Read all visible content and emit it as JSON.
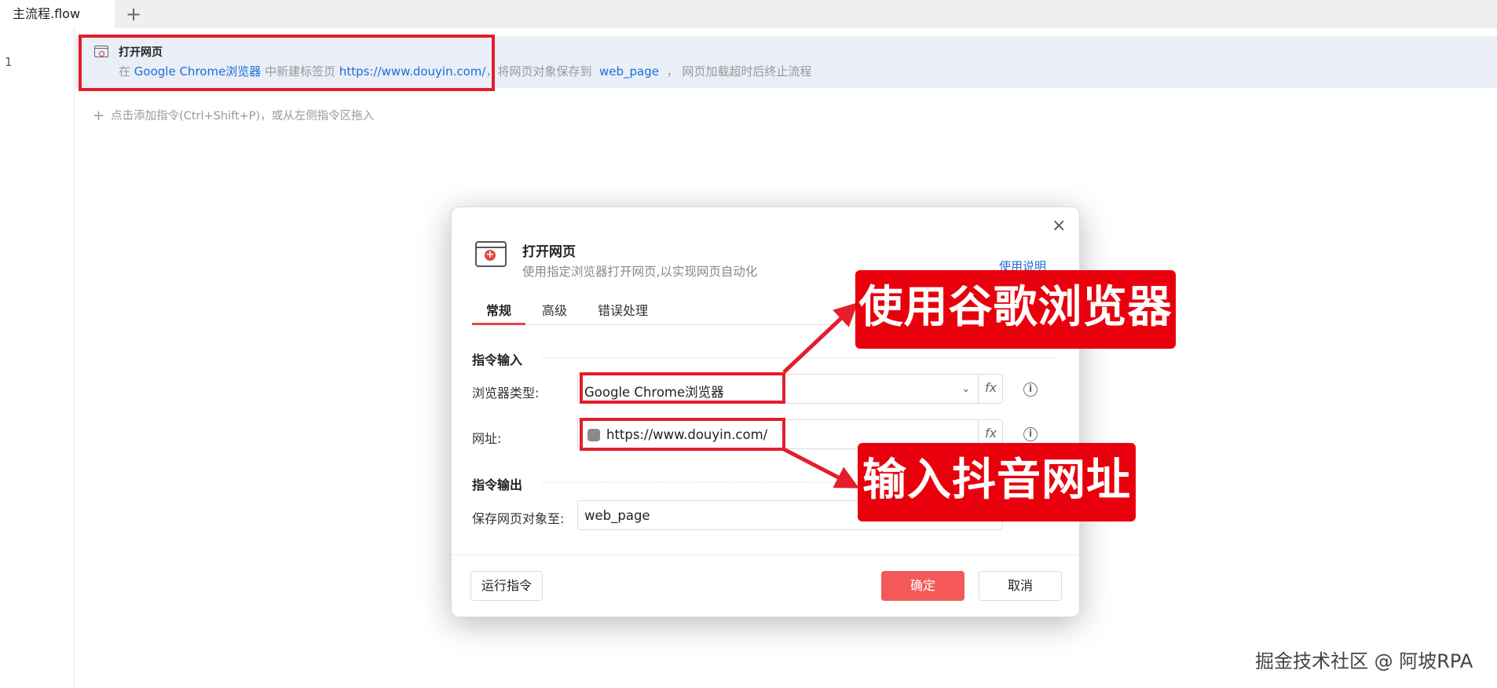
{
  "tabbar": {
    "active_tab": "主流程.flow",
    "add_glyph": "+"
  },
  "editor": {
    "line_number": "1",
    "command": {
      "title": "打开网页",
      "desc_prefix": "在",
      "browser": "Google Chrome浏览器",
      "desc_mid": "中新建标签页",
      "url": "https://www.douyin.com/",
      "desc_save": "，将网页对象保存到",
      "var": "web_page",
      "desc_suffix": "， 网页加载超时后终止流程"
    },
    "add_hint": "点击添加指令(Ctrl+Shift+P)，或从左侧指令区拖入"
  },
  "dialog": {
    "title": "打开网页",
    "subtitle": "使用指定浏览器打开网页,以实现网页自动化",
    "help_link": "使用说明",
    "tabs": [
      "常规",
      "高级",
      "错误处理"
    ],
    "input_section": "指令输入",
    "output_section": "指令输出",
    "fields": {
      "browser_label": "浏览器类型:",
      "browser_value": "Google Chrome浏览器",
      "url_label": "网址:",
      "url_value": "https://www.douyin.com/",
      "save_label": "保存网页对象至:",
      "save_value": "web_page"
    },
    "fx_glyph": "fx",
    "info_glyph": "i",
    "buttons": {
      "run": "运行指令",
      "ok": "确定",
      "cancel": "取消"
    }
  },
  "annotations": {
    "callout_browser": "使用谷歌浏览器",
    "callout_url": "输入抖音网址",
    "color": "#e8000d"
  },
  "watermark": "掘金技术社区 @ 阿坡RPA"
}
